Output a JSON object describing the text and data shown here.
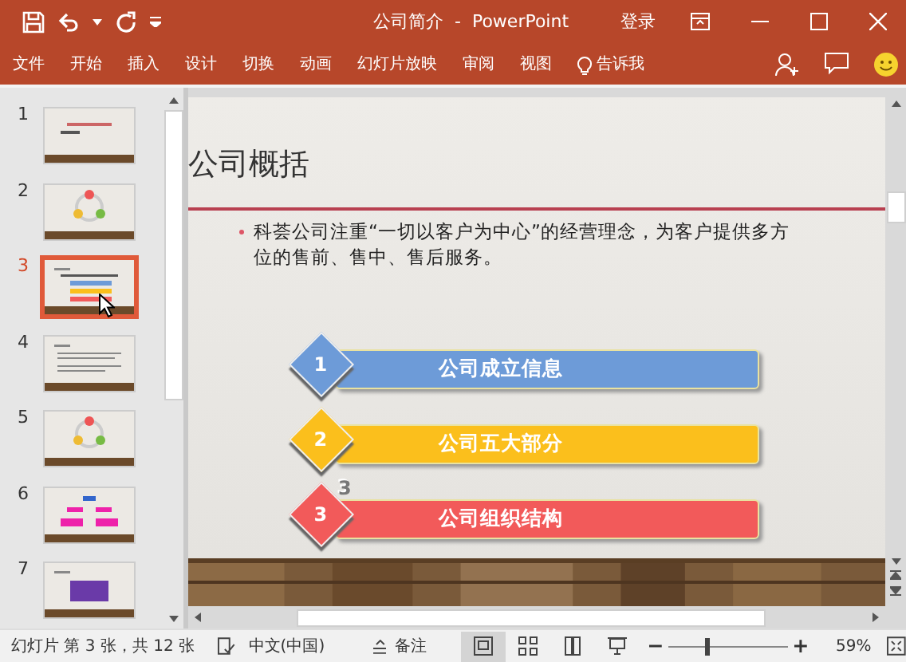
{
  "window": {
    "title": "公司简介  -  PowerPoint",
    "signin": "登录"
  },
  "ribbon_tabs": [
    {
      "label": "文件"
    },
    {
      "label": "开始"
    },
    {
      "label": "插入"
    },
    {
      "label": "设计"
    },
    {
      "label": "切换"
    },
    {
      "label": "动画"
    },
    {
      "label": "幻灯片放映"
    },
    {
      "label": "审阅"
    },
    {
      "label": "视图"
    }
  ],
  "tell_me": "告诉我",
  "thumbnails": [
    {
      "number": "1",
      "selected": false,
      "kind": "title"
    },
    {
      "number": "2",
      "selected": false,
      "kind": "cycle"
    },
    {
      "number": "3",
      "selected": true,
      "kind": "list"
    },
    {
      "number": "4",
      "selected": false,
      "kind": "text"
    },
    {
      "number": "5",
      "selected": false,
      "kind": "cycle"
    },
    {
      "number": "6",
      "selected": false,
      "kind": "org"
    },
    {
      "number": "7",
      "selected": false,
      "kind": "box"
    }
  ],
  "slide": {
    "title": "公司概括",
    "bullet": "科荟公司注重“一切以客户为中心”的经营理念，为客户提供多方位的售前、售中、售后服务。",
    "items": [
      {
        "number": "1",
        "label": "公司成立信息",
        "color": "#6d9bd8"
      },
      {
        "number": "2",
        "label": "公司五大部分",
        "color": "#fbbf1c"
      },
      {
        "number": "3",
        "label": "公司组织结构",
        "color": "#f25a5a"
      }
    ],
    "stray_label": "3"
  },
  "status_bar": {
    "slide_info": "幻灯片 第 3 张，共 12 张",
    "language": "中文(中国)",
    "notes": "备注",
    "views": [
      {
        "kind": "normal",
        "selected": true
      },
      {
        "kind": "sorter",
        "selected": false
      },
      {
        "kind": "reading",
        "selected": false
      },
      {
        "kind": "show",
        "selected": false
      }
    ],
    "zoom": {
      "level": 0.3,
      "reading": "59%"
    }
  }
}
